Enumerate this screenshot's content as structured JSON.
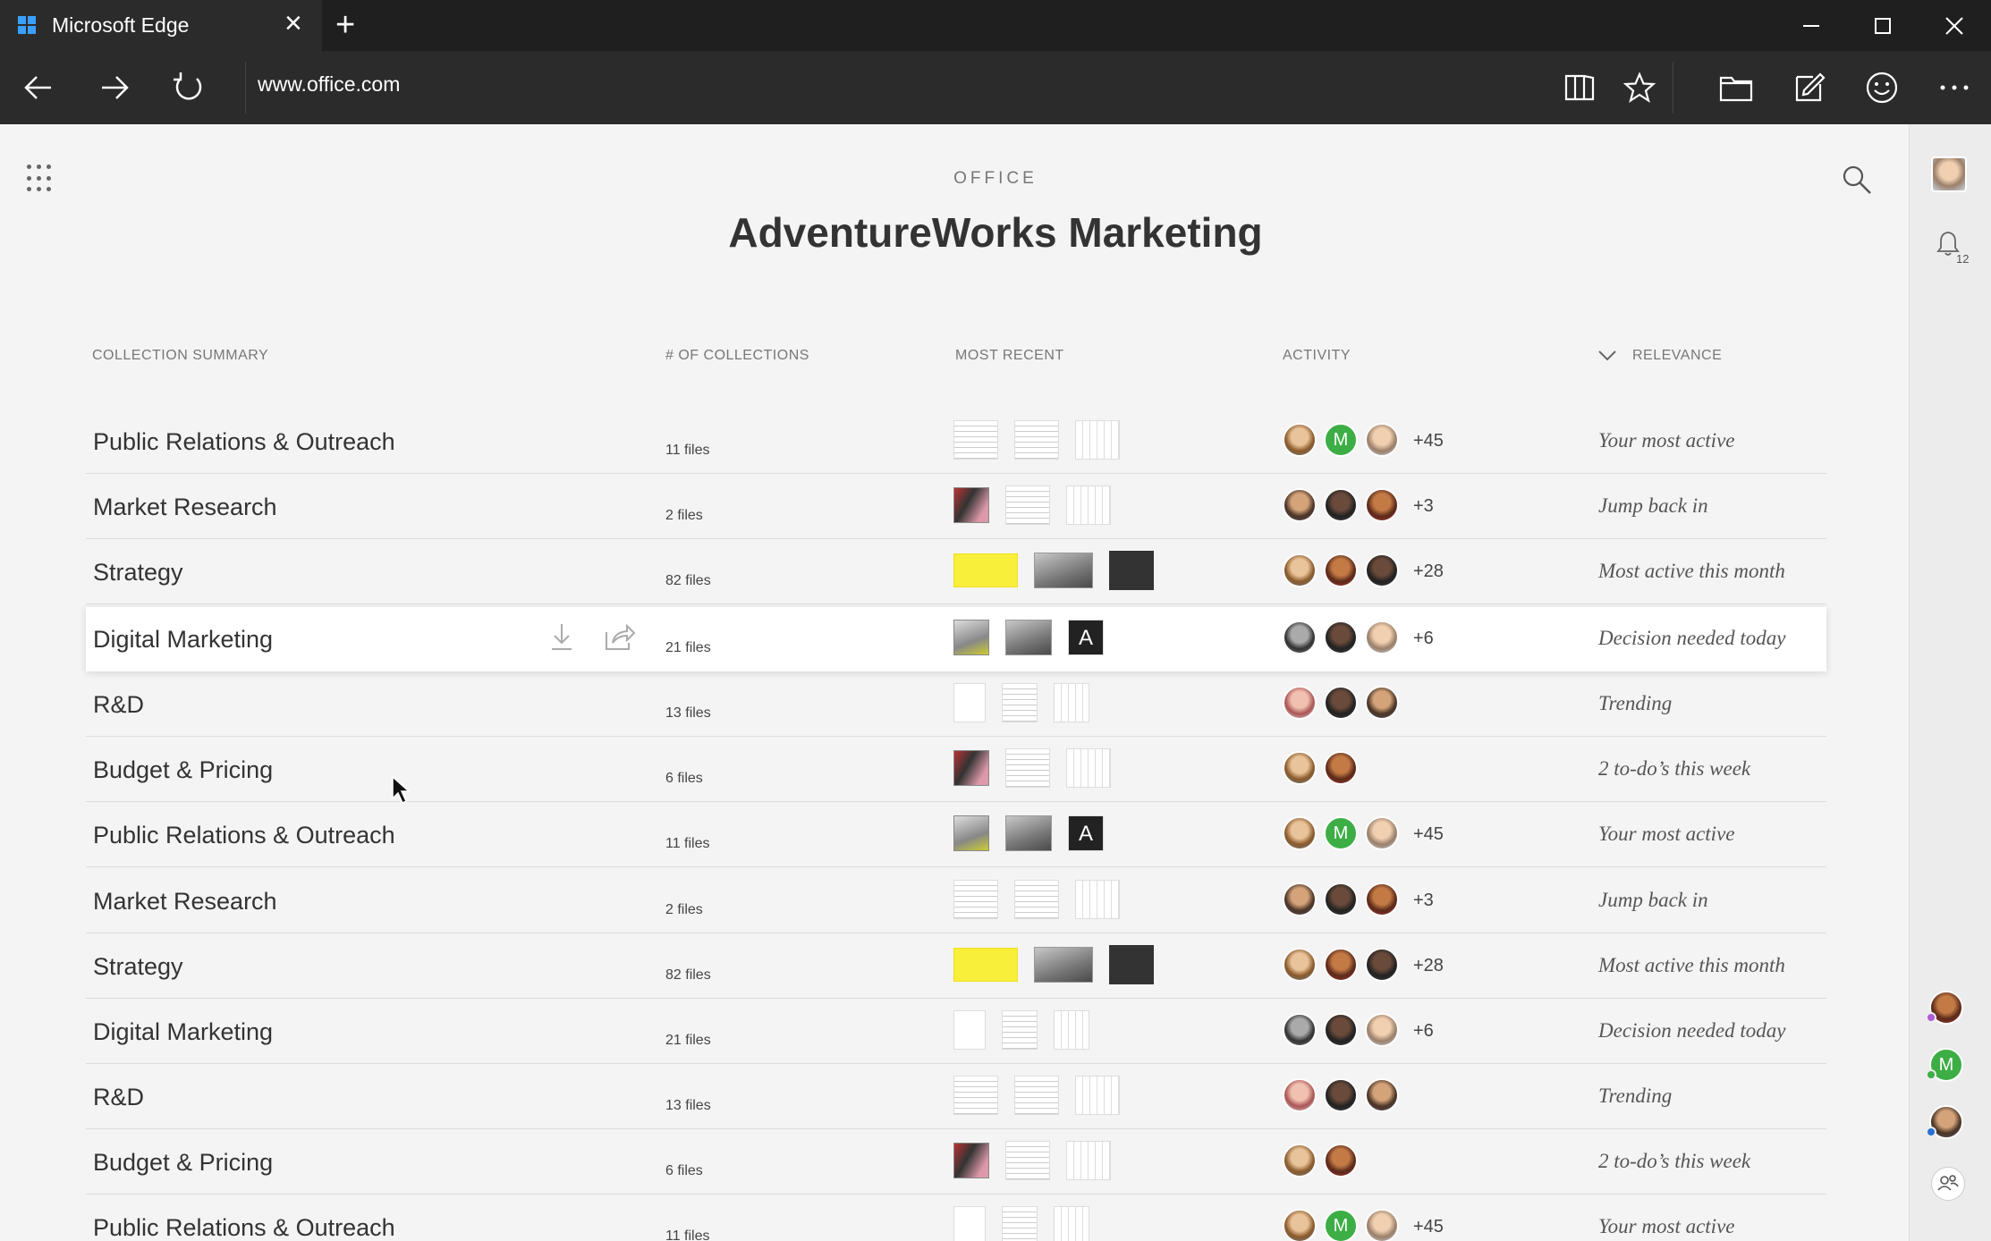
{
  "browser": {
    "tab_title": "Microsoft Edge",
    "address": "www.office.com"
  },
  "header": {
    "brand": "OFFICE",
    "title": "AdventureWorks Marketing"
  },
  "columns": {
    "summary": "COLLECTION SUMMARY",
    "count": "# OF COLLECTIONS",
    "recent": "MOST RECENT",
    "activity": "ACTIVITY",
    "relevance": "RELEVANCE"
  },
  "rows": [
    {
      "name": "Public Relations & Outreach",
      "files": "11 files",
      "more": "+45",
      "relevance": "Your most active"
    },
    {
      "name": "Market Research",
      "files": "2 files",
      "more": "+3",
      "relevance": "Jump back in"
    },
    {
      "name": "Strategy",
      "files": "82 files",
      "more": "+28",
      "relevance": "Most active this month"
    },
    {
      "name": "Digital Marketing",
      "files": "21 files",
      "more": "+6",
      "relevance": "Decision needed today"
    },
    {
      "name": "R&D",
      "files": "13 files",
      "more": "",
      "relevance": "Trending"
    },
    {
      "name": "Budget & Pricing",
      "files": "6 files",
      "more": "",
      "relevance": "2 to-do’s this week"
    },
    {
      "name": "Public Relations & Outreach",
      "files": "11 files",
      "more": "+45",
      "relevance": "Your most active"
    },
    {
      "name": "Market Research",
      "files": "2 files",
      "more": "+3",
      "relevance": "Jump back in"
    },
    {
      "name": "Strategy",
      "files": "82 files",
      "more": "+28",
      "relevance": "Most active this month"
    },
    {
      "name": "Digital Marketing",
      "files": "21 files",
      "more": "+6",
      "relevance": "Decision needed today"
    },
    {
      "name": "R&D",
      "files": "13 files",
      "more": "",
      "relevance": "Trending"
    },
    {
      "name": "Budget & Pricing",
      "files": "6 files",
      "more": "",
      "relevance": "2 to-do’s this week"
    },
    {
      "name": "Public Relations & Outreach",
      "files": "11 files",
      "more": "+45",
      "relevance": "Your most active"
    }
  ],
  "rail": {
    "notification_count": "12",
    "avatar_initial": "M"
  },
  "avatar_initial": "M",
  "colors": {
    "accent_green": "#3dae45",
    "chrome_dark": "#2b2b2b",
    "highlight_row": "#ffffff"
  }
}
